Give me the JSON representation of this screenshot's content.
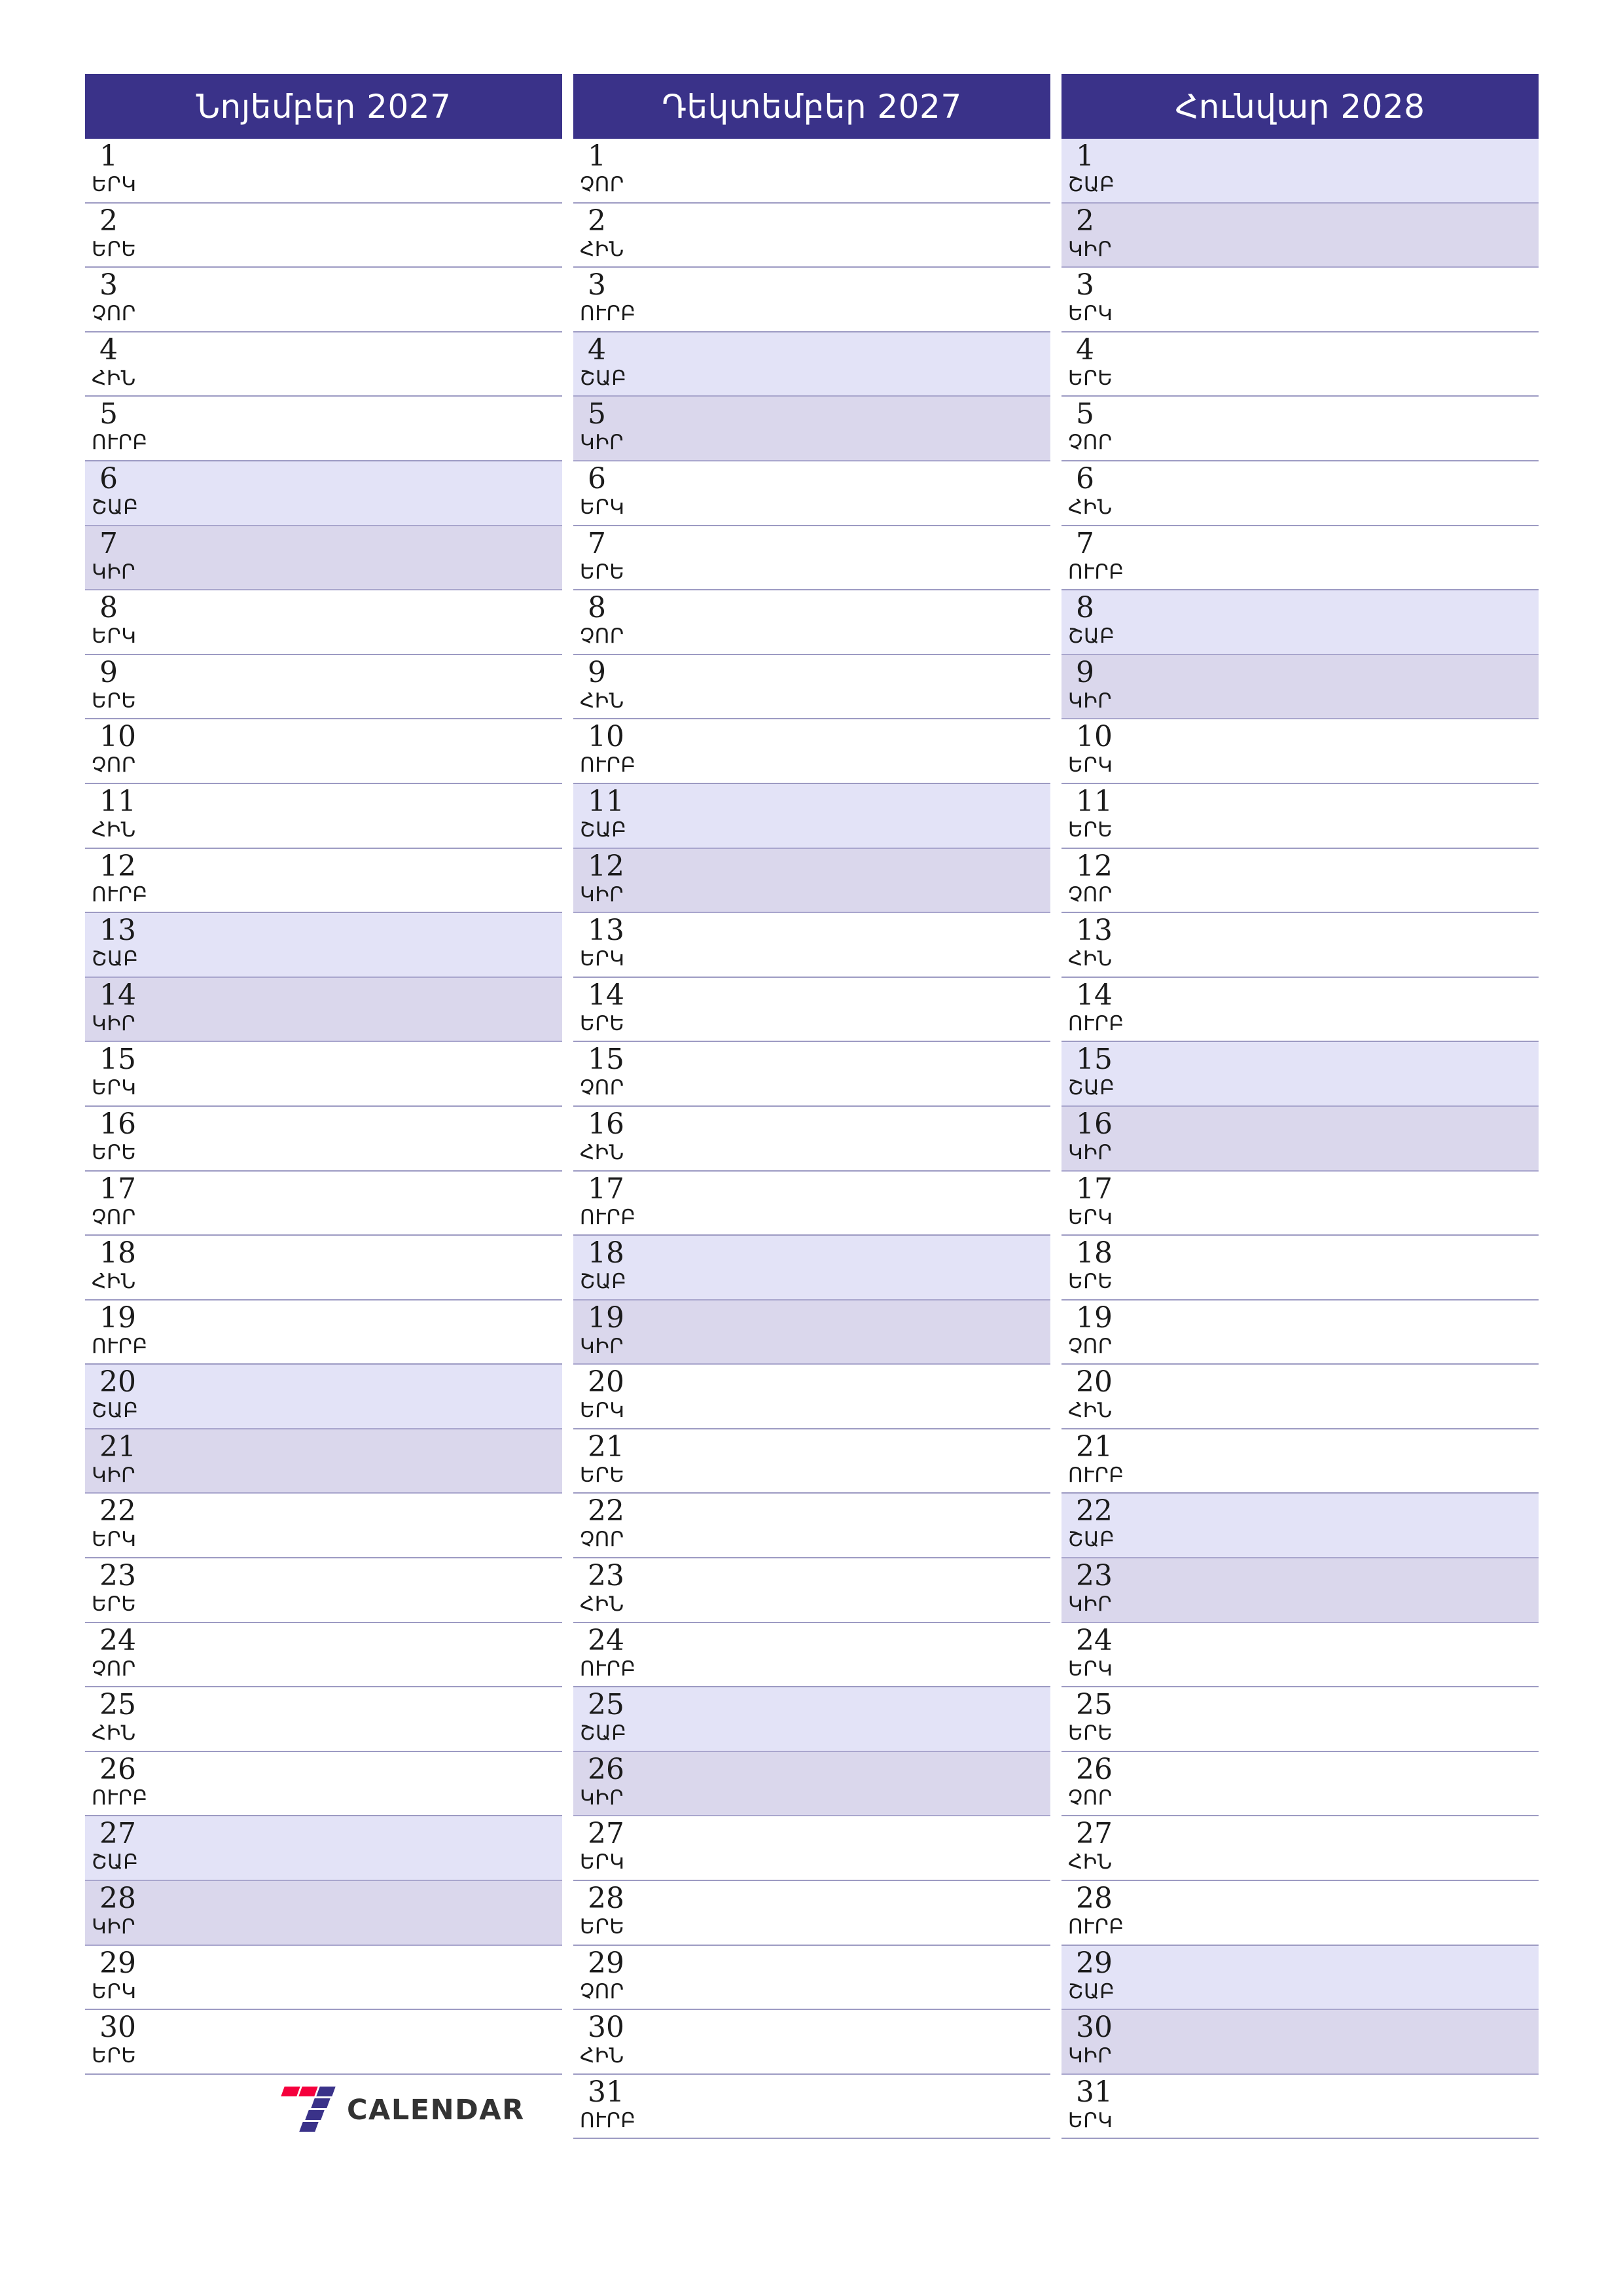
{
  "brand": {
    "logo_icon": "seven-calendar-logo-icon",
    "name": "CALENDAR",
    "mark_red": "#f5003c",
    "mark_purple": "#3a3289"
  },
  "theme": {
    "header_bg": "#3a3289",
    "header_text": "#ffffff",
    "saturday_bg": "#e3e3f7",
    "sunday_bg": "#dad7ec",
    "grid_line": "#9d9bc3",
    "day_text": "#1b1b1b"
  },
  "weekday_abbr": {
    "mon": "ԵՐԿ",
    "tue": "ԵՐԵ",
    "wed": "ՉՈՐ",
    "thu": "ՀԻՆ",
    "fri": "ՈՒՐԲ",
    "sat": "ՇԱԲ",
    "sun": "ԿԻՐ"
  },
  "months": [
    {
      "title": "Նոյեմբեր 2027",
      "days": [
        {
          "n": "1",
          "w": "ԵՐԿ",
          "t": "wd"
        },
        {
          "n": "2",
          "w": "ԵՐԵ",
          "t": "wd"
        },
        {
          "n": "3",
          "w": "ՉՈՐ",
          "t": "wd"
        },
        {
          "n": "4",
          "w": "ՀԻՆ",
          "t": "wd"
        },
        {
          "n": "5",
          "w": "ՈՒՐԲ",
          "t": "wd"
        },
        {
          "n": "6",
          "w": "ՇԱԲ",
          "t": "sat"
        },
        {
          "n": "7",
          "w": "ԿԻՐ",
          "t": "sun"
        },
        {
          "n": "8",
          "w": "ԵՐԿ",
          "t": "wd"
        },
        {
          "n": "9",
          "w": "ԵՐԵ",
          "t": "wd"
        },
        {
          "n": "10",
          "w": "ՉՈՐ",
          "t": "wd"
        },
        {
          "n": "11",
          "w": "ՀԻՆ",
          "t": "wd"
        },
        {
          "n": "12",
          "w": "ՈՒՐԲ",
          "t": "wd"
        },
        {
          "n": "13",
          "w": "ՇԱԲ",
          "t": "sat"
        },
        {
          "n": "14",
          "w": "ԿԻՐ",
          "t": "sun"
        },
        {
          "n": "15",
          "w": "ԵՐԿ",
          "t": "wd"
        },
        {
          "n": "16",
          "w": "ԵՐԵ",
          "t": "wd"
        },
        {
          "n": "17",
          "w": "ՉՈՐ",
          "t": "wd"
        },
        {
          "n": "18",
          "w": "ՀԻՆ",
          "t": "wd"
        },
        {
          "n": "19",
          "w": "ՈՒՐԲ",
          "t": "wd"
        },
        {
          "n": "20",
          "w": "ՇԱԲ",
          "t": "sat"
        },
        {
          "n": "21",
          "w": "ԿԻՐ",
          "t": "sun"
        },
        {
          "n": "22",
          "w": "ԵՐԿ",
          "t": "wd"
        },
        {
          "n": "23",
          "w": "ԵՐԵ",
          "t": "wd"
        },
        {
          "n": "24",
          "w": "ՉՈՐ",
          "t": "wd"
        },
        {
          "n": "25",
          "w": "ՀԻՆ",
          "t": "wd"
        },
        {
          "n": "26",
          "w": "ՈՒՐԲ",
          "t": "wd"
        },
        {
          "n": "27",
          "w": "ՇԱԲ",
          "t": "sat"
        },
        {
          "n": "28",
          "w": "ԿԻՐ",
          "t": "sun"
        },
        {
          "n": "29",
          "w": "ԵՐԿ",
          "t": "wd"
        },
        {
          "n": "30",
          "w": "ԵՐԵ",
          "t": "wd"
        }
      ]
    },
    {
      "title": "Դեկտեմբեր 2027",
      "days": [
        {
          "n": "1",
          "w": "ՉՈՐ",
          "t": "wd"
        },
        {
          "n": "2",
          "w": "ՀԻՆ",
          "t": "wd"
        },
        {
          "n": "3",
          "w": "ՈՒՐԲ",
          "t": "wd"
        },
        {
          "n": "4",
          "w": "ՇԱԲ",
          "t": "sat"
        },
        {
          "n": "5",
          "w": "ԿԻՐ",
          "t": "sun"
        },
        {
          "n": "6",
          "w": "ԵՐԿ",
          "t": "wd"
        },
        {
          "n": "7",
          "w": "ԵՐԵ",
          "t": "wd"
        },
        {
          "n": "8",
          "w": "ՉՈՐ",
          "t": "wd"
        },
        {
          "n": "9",
          "w": "ՀԻՆ",
          "t": "wd"
        },
        {
          "n": "10",
          "w": "ՈՒՐԲ",
          "t": "wd"
        },
        {
          "n": "11",
          "w": "ՇԱԲ",
          "t": "sat"
        },
        {
          "n": "12",
          "w": "ԿԻՐ",
          "t": "sun"
        },
        {
          "n": "13",
          "w": "ԵՐԿ",
          "t": "wd"
        },
        {
          "n": "14",
          "w": "ԵՐԵ",
          "t": "wd"
        },
        {
          "n": "15",
          "w": "ՉՈՐ",
          "t": "wd"
        },
        {
          "n": "16",
          "w": "ՀԻՆ",
          "t": "wd"
        },
        {
          "n": "17",
          "w": "ՈՒՐԲ",
          "t": "wd"
        },
        {
          "n": "18",
          "w": "ՇԱԲ",
          "t": "sat"
        },
        {
          "n": "19",
          "w": "ԿԻՐ",
          "t": "sun"
        },
        {
          "n": "20",
          "w": "ԵՐԿ",
          "t": "wd"
        },
        {
          "n": "21",
          "w": "ԵՐԵ",
          "t": "wd"
        },
        {
          "n": "22",
          "w": "ՉՈՐ",
          "t": "wd"
        },
        {
          "n": "23",
          "w": "ՀԻՆ",
          "t": "wd"
        },
        {
          "n": "24",
          "w": "ՈՒՐԲ",
          "t": "wd"
        },
        {
          "n": "25",
          "w": "ՇԱԲ",
          "t": "sat"
        },
        {
          "n": "26",
          "w": "ԿԻՐ",
          "t": "sun"
        },
        {
          "n": "27",
          "w": "ԵՐԿ",
          "t": "wd"
        },
        {
          "n": "28",
          "w": "ԵՐԵ",
          "t": "wd"
        },
        {
          "n": "29",
          "w": "ՉՈՐ",
          "t": "wd"
        },
        {
          "n": "30",
          "w": "ՀԻՆ",
          "t": "wd"
        },
        {
          "n": "31",
          "w": "ՈՒՐԲ",
          "t": "wd"
        }
      ]
    },
    {
      "title": "Հունվար 2028",
      "days": [
        {
          "n": "1",
          "w": "ՇԱԲ",
          "t": "sat"
        },
        {
          "n": "2",
          "w": "ԿԻՐ",
          "t": "sun"
        },
        {
          "n": "3",
          "w": "ԵՐԿ",
          "t": "wd"
        },
        {
          "n": "4",
          "w": "ԵՐԵ",
          "t": "wd"
        },
        {
          "n": "5",
          "w": "ՉՈՐ",
          "t": "wd"
        },
        {
          "n": "6",
          "w": "ՀԻՆ",
          "t": "wd"
        },
        {
          "n": "7",
          "w": "ՈՒՐԲ",
          "t": "wd"
        },
        {
          "n": "8",
          "w": "ՇԱԲ",
          "t": "sat"
        },
        {
          "n": "9",
          "w": "ԿԻՐ",
          "t": "sun"
        },
        {
          "n": "10",
          "w": "ԵՐԿ",
          "t": "wd"
        },
        {
          "n": "11",
          "w": "ԵՐԵ",
          "t": "wd"
        },
        {
          "n": "12",
          "w": "ՉՈՐ",
          "t": "wd"
        },
        {
          "n": "13",
          "w": "ՀԻՆ",
          "t": "wd"
        },
        {
          "n": "14",
          "w": "ՈՒՐԲ",
          "t": "wd"
        },
        {
          "n": "15",
          "w": "ՇԱԲ",
          "t": "sat"
        },
        {
          "n": "16",
          "w": "ԿԻՐ",
          "t": "sun"
        },
        {
          "n": "17",
          "w": "ԵՐԿ",
          "t": "wd"
        },
        {
          "n": "18",
          "w": "ԵՐԵ",
          "t": "wd"
        },
        {
          "n": "19",
          "w": "ՉՈՐ",
          "t": "wd"
        },
        {
          "n": "20",
          "w": "ՀԻՆ",
          "t": "wd"
        },
        {
          "n": "21",
          "w": "ՈՒՐԲ",
          "t": "wd"
        },
        {
          "n": "22",
          "w": "ՇԱԲ",
          "t": "sat"
        },
        {
          "n": "23",
          "w": "ԿԻՐ",
          "t": "sun"
        },
        {
          "n": "24",
          "w": "ԵՐԿ",
          "t": "wd"
        },
        {
          "n": "25",
          "w": "ԵՐԵ",
          "t": "wd"
        },
        {
          "n": "26",
          "w": "ՉՈՐ",
          "t": "wd"
        },
        {
          "n": "27",
          "w": "ՀԻՆ",
          "t": "wd"
        },
        {
          "n": "28",
          "w": "ՈՒՐԲ",
          "t": "wd"
        },
        {
          "n": "29",
          "w": "ՇԱԲ",
          "t": "sat"
        },
        {
          "n": "30",
          "w": "ԿԻՐ",
          "t": "sun"
        },
        {
          "n": "31",
          "w": "ԵՐԿ",
          "t": "wd"
        }
      ]
    }
  ]
}
